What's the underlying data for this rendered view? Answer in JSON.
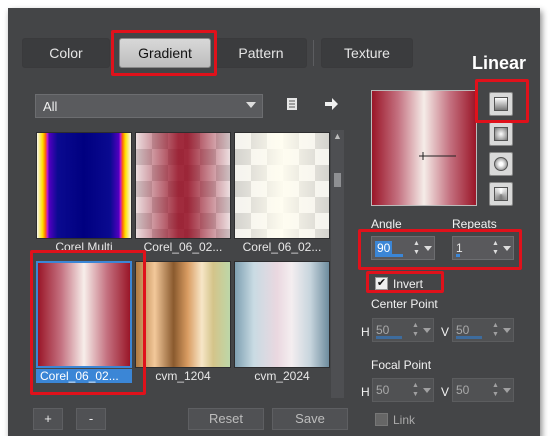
{
  "tabs": [
    {
      "label": "Color"
    },
    {
      "label": "Gradient"
    },
    {
      "label": "Pattern"
    },
    {
      "label": "Texture"
    }
  ],
  "heading": "Linear",
  "filter": {
    "selected": "All"
  },
  "thumbnails": [
    {
      "label": "Corel Multi"
    },
    {
      "label": "Corel_06_02..."
    },
    {
      "label": "Corel_06_02..."
    },
    {
      "label": "Corel_06_02..."
    },
    {
      "label": "cvm_1204"
    },
    {
      "label": "cvm_2024"
    }
  ],
  "angle": {
    "label": "Angle",
    "value": "90"
  },
  "repeats": {
    "label": "Repeats",
    "value": "1"
  },
  "invert": {
    "label": "Invert",
    "checked": true
  },
  "center_point": {
    "label": "Center Point",
    "h_label": "H",
    "h_value": "50",
    "v_label": "V",
    "v_value": "50"
  },
  "focal_point": {
    "label": "Focal Point",
    "h_label": "H",
    "h_value": "50",
    "v_label": "V",
    "v_value": "50"
  },
  "link": {
    "label": "Link"
  },
  "buttons": {
    "add": "+",
    "remove": "-",
    "reset": "Reset",
    "save": "Save"
  },
  "colors": {
    "accent": "#3b86d6",
    "highlight_box": "#e0111b",
    "panel": "#444547"
  }
}
